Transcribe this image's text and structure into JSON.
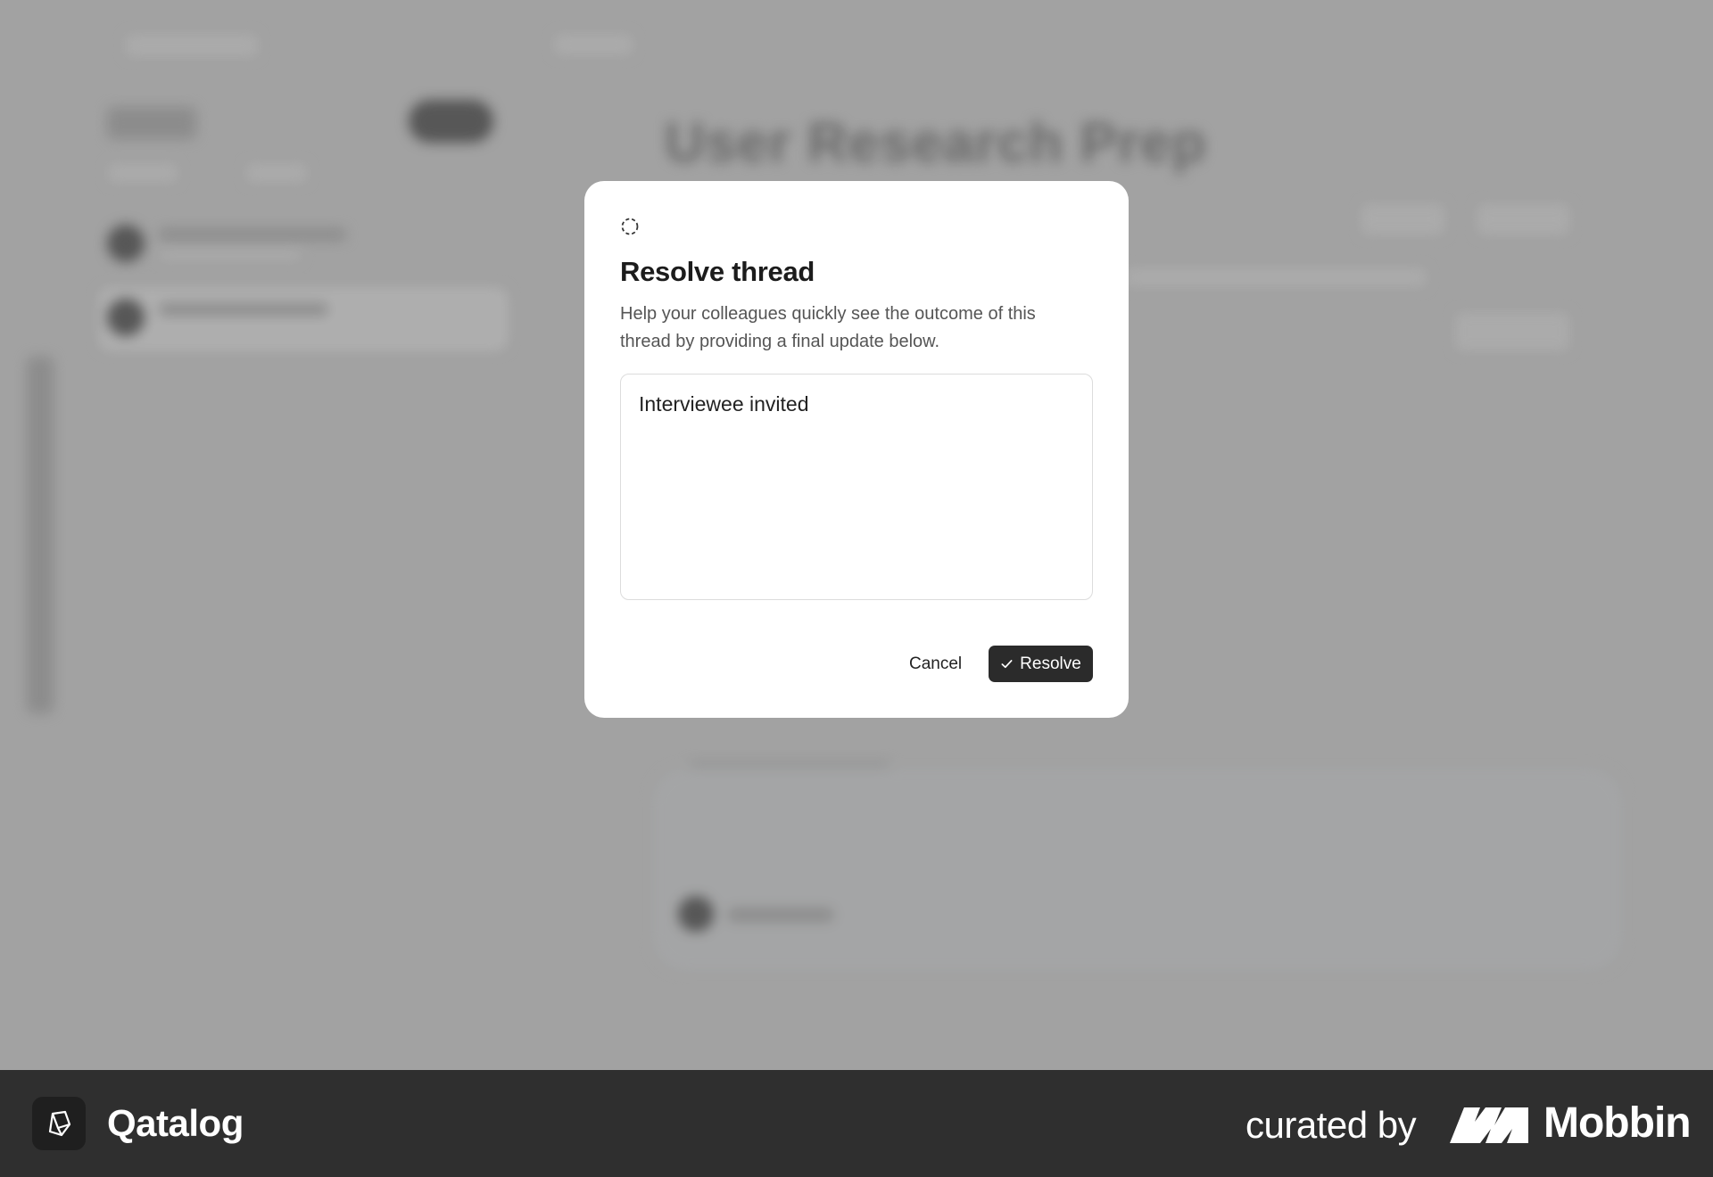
{
  "background": {
    "page_title": "User Research Prep"
  },
  "modal": {
    "icon": "dashed-circle-icon",
    "title": "Resolve thread",
    "description": "Help your colleagues quickly see the outcome of this thread by providing a final update below.",
    "textarea_value": "Interviewee invited",
    "cancel_label": "Cancel",
    "resolve_label": "Resolve",
    "resolve_icon": "check-icon"
  },
  "footer": {
    "app_name": "Qatalog",
    "app_logo_icon": "qatalog-logo-icon",
    "curated_by": "curated by",
    "brand": "Mobbin",
    "brand_logo_icon": "mobbin-logo-icon"
  },
  "colors": {
    "resolve_button_bg": "#2b2b2b",
    "footer_bg": "#2f2f2f",
    "backdrop": "#a6a6a6"
  }
}
